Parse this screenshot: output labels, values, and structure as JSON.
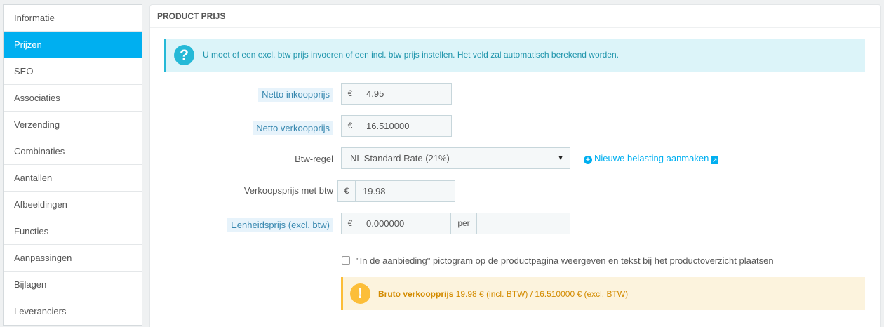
{
  "sidebar": {
    "items": [
      {
        "label": "Informatie"
      },
      {
        "label": "Prijzen"
      },
      {
        "label": "SEO"
      },
      {
        "label": "Associaties"
      },
      {
        "label": "Verzending"
      },
      {
        "label": "Combinaties"
      },
      {
        "label": "Aantallen"
      },
      {
        "label": "Afbeeldingen"
      },
      {
        "label": "Functies"
      },
      {
        "label": "Aanpassingen"
      },
      {
        "label": "Bijlagen"
      },
      {
        "label": "Leveranciers"
      }
    ],
    "active": "Prijzen"
  },
  "panel": {
    "title": "PRODUCT PRIJS",
    "info_icon": "?",
    "info_text": "U moet of een excl. btw prijs invoeren of een incl. btw prijs instellen. Het veld zal automatisch berekend worden."
  },
  "form": {
    "netto_inkoop": {
      "label": "Netto inkoopprijs",
      "currency": "€",
      "value": "4.95"
    },
    "netto_verkoop": {
      "label": "Netto verkoopprijs",
      "currency": "€",
      "value": "16.510000"
    },
    "btw_regel": {
      "label": "Btw-regel",
      "selected": "NL Standard Rate (21%)"
    },
    "new_tax_link": "Nieuwe belasting aanmaken",
    "verkoop_btw": {
      "label": "Verkoopsprijs met btw",
      "currency": "€",
      "value": "19.98"
    },
    "eenheidsprijs": {
      "label": "Eenheidsprijs (excl. btw)",
      "currency": "€",
      "value": "0.000000",
      "per_label": "per",
      "unit_value": ""
    },
    "on_sale_label": "\"In de aanbieding\" pictogram op de productpagina weergeven en tekst bij het productoverzicht plaatsen",
    "on_sale_checked": false
  },
  "warning": {
    "icon": "!",
    "bold": "Bruto verkoopprijs",
    "text": " 19.98 € (incl. BTW) / 16.510000 € (excl. BTW)"
  },
  "colors": {
    "accent": "#00aff0",
    "info": "#25b9d7",
    "warning": "#fcbe39"
  }
}
